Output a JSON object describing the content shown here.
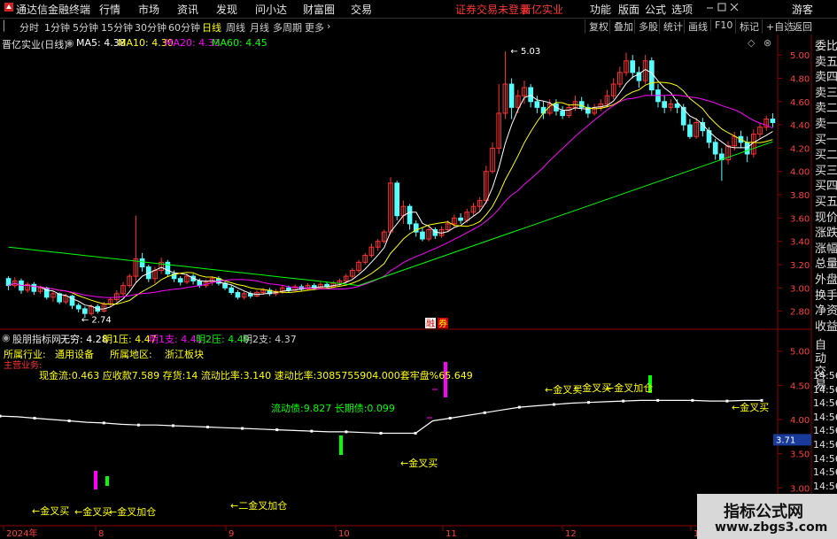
{
  "topbar": {
    "app_title": "通达信金融终端",
    "menu": [
      "行情",
      "市场",
      "资讯",
      "发现",
      "问小达",
      "财富圈",
      "交易"
    ],
    "notice": "证券交易未登录",
    "stock_name": "晋亿实业",
    "right": [
      "功能",
      "版面",
      "公式",
      "选项"
    ],
    "user": "游客"
  },
  "periods": [
    "分时",
    "1分钟",
    "5分钟",
    "15分钟",
    "30分钟",
    "60分钟",
    "日线",
    "周线",
    "月线",
    "多周期",
    "更多"
  ],
  "active_period": "日线",
  "toolbar": [
    "复权",
    "叠加",
    "多股",
    "统计",
    "画线",
    "F10",
    "标记",
    "+自选",
    "返回"
  ],
  "main_chart": {
    "title": "晋亿实业(日线)",
    "ma_legend": [
      {
        "label": "MA5: 4.38",
        "color": "#ffffff"
      },
      {
        "label": "MA10: 4.30",
        "color": "#ffff00"
      },
      {
        "label": "MA20: 4.33",
        "color": "#ff00ff"
      },
      {
        "label": "MA60: 4.45",
        "color": "#00ff00"
      }
    ],
    "y_ticks": [
      "5.00",
      "4.80",
      "4.60",
      "4.40",
      "4.20",
      "4.00",
      "3.80",
      "3.60",
      "3.40",
      "3.20",
      "3.00",
      "2.80"
    ],
    "high_label": "5.03",
    "low_label": "2.74",
    "marker_texts": [
      "融",
      "券"
    ]
  },
  "indicator": {
    "title": "股朋指标网",
    "values": [
      {
        "label": "无穷: 4.28",
        "color": "#ffffff"
      },
      {
        "label": "明1压: 4.47",
        "color": "#ffff00"
      },
      {
        "label": "明1支: 4.41",
        "color": "#ff00ff"
      },
      {
        "label": "明2压: 4.49",
        "color": "#00ff00"
      },
      {
        "label": "明2支: 4.37",
        "color": "#cccccc"
      }
    ],
    "industry_label": "所属行业:",
    "industry": "通用设备",
    "region_label": "所属地区:",
    "region": "浙江板块",
    "business_label": "主营业务:",
    "finance_line": "现金流:0.463    应收款7.589   存货:14      流动比率:3.140  速动比率:3085755904.000套牢盘%65.649",
    "debt_line": "流动债:9.827    长期债:0.099",
    "y_ticks": [
      "5.00",
      "4.50",
      "4.00",
      "3.50",
      "3.00"
    ],
    "current_value": "3.71",
    "annotations": [
      "←金叉买",
      "←金叉买",
      "←二金叉加仓",
      "←金叉买",
      "←金叉买",
      "←金叉买",
      "←金叉买",
      "←金叉加仓",
      "←金叉加仓"
    ]
  },
  "right_panel": {
    "items": [
      "委比",
      "卖五",
      "卖四",
      "卖三",
      "卖二",
      "卖一",
      "买一",
      "买二",
      "买三",
      "买四",
      "买五",
      "现价",
      "涨跌",
      "涨幅",
      "总量",
      "外盘",
      "换手",
      "净资",
      "收益"
    ],
    "lower_items": [
      "自动",
      "交易"
    ],
    "times": [
      "14:56",
      "14:56",
      "14:56",
      "14:56",
      "14:56",
      "14:56",
      "14:56",
      "14:56",
      "14:56"
    ]
  },
  "x_axis": [
    "2024年",
    "8",
    "9",
    "10",
    "11",
    "12",
    "1"
  ],
  "watermark": {
    "title": "指标公式网",
    "url": "www.zbgs3.com"
  },
  "colors": {
    "up": "#ff3232",
    "down": "#54ffff",
    "ma5": "#ffffff",
    "ma10": "#ffff00",
    "ma20": "#ff00ff",
    "ma60": "#00ff00"
  },
  "chart_data": {
    "type": "candlestick",
    "title": "晋亿实业(日线)",
    "ylim": [
      2.7,
      5.1
    ],
    "candles": [
      [
        3.08,
        3.02,
        3.1,
        2.98
      ],
      [
        3.02,
        3.06,
        3.09,
        3.0
      ],
      [
        3.06,
        2.98,
        3.08,
        2.95
      ],
      [
        2.98,
        3.03,
        3.05,
        2.96
      ],
      [
        3.03,
        2.97,
        3.05,
        2.94
      ],
      [
        2.97,
        3.0,
        3.02,
        2.95
      ],
      [
        3.0,
        2.92,
        3.01,
        2.9
      ],
      [
        2.92,
        2.95,
        2.97,
        2.88
      ],
      [
        2.95,
        2.88,
        2.96,
        2.86
      ],
      [
        2.88,
        2.93,
        2.95,
        2.86
      ],
      [
        2.93,
        2.85,
        2.94,
        2.82
      ],
      [
        2.85,
        2.82,
        2.87,
        2.79
      ],
      [
        2.82,
        2.78,
        2.84,
        2.74
      ],
      [
        2.78,
        2.84,
        2.86,
        2.76
      ],
      [
        2.84,
        2.8,
        2.86,
        2.78
      ],
      [
        2.8,
        2.86,
        2.88,
        2.79
      ],
      [
        2.86,
        2.9,
        2.92,
        2.84
      ],
      [
        2.9,
        2.95,
        2.98,
        2.88
      ],
      [
        2.95,
        3.02,
        3.05,
        2.93
      ],
      [
        3.02,
        3.1,
        3.12,
        3.0
      ],
      [
        3.1,
        3.25,
        3.62,
        3.05
      ],
      [
        3.25,
        3.18,
        3.3,
        3.14
      ],
      [
        3.18,
        3.08,
        3.2,
        3.05
      ],
      [
        3.08,
        3.15,
        3.18,
        3.04
      ],
      [
        3.15,
        3.22,
        3.26,
        3.12
      ],
      [
        3.22,
        3.12,
        3.24,
        3.1
      ],
      [
        3.12,
        3.08,
        3.15,
        3.05
      ],
      [
        3.08,
        3.05,
        3.1,
        3.02
      ],
      [
        3.05,
        3.1,
        3.12,
        3.03
      ],
      [
        3.1,
        3.06,
        3.12,
        3.03
      ],
      [
        3.06,
        3.02,
        3.08,
        3.0
      ],
      [
        3.02,
        3.05,
        3.07,
        3.0
      ],
      [
        3.05,
        3.08,
        3.1,
        3.02
      ],
      [
        3.08,
        3.04,
        3.1,
        3.02
      ],
      [
        3.04,
        3.0,
        3.06,
        2.98
      ],
      [
        3.0,
        2.96,
        3.02,
        2.94
      ],
      [
        2.96,
        2.92,
        2.98,
        2.9
      ],
      [
        2.92,
        2.95,
        2.97,
        2.9
      ],
      [
        2.95,
        2.93,
        2.97,
        2.91
      ],
      [
        2.93,
        2.96,
        2.98,
        2.92
      ],
      [
        2.96,
        2.98,
        3.0,
        2.94
      ],
      [
        2.98,
        2.95,
        3.0,
        2.93
      ],
      [
        2.95,
        2.97,
        2.99,
        2.93
      ],
      [
        2.97,
        3.0,
        3.02,
        2.95
      ],
      [
        3.0,
        2.98,
        3.02,
        2.96
      ],
      [
        2.98,
        3.01,
        3.03,
        2.97
      ],
      [
        3.01,
        2.99,
        3.03,
        2.97
      ],
      [
        2.99,
        3.02,
        3.04,
        2.98
      ],
      [
        3.02,
        3.0,
        3.04,
        2.98
      ],
      [
        3.0,
        3.03,
        3.05,
        2.99
      ],
      [
        3.03,
        3.01,
        3.05,
        2.99
      ],
      [
        3.01,
        3.04,
        3.06,
        3.0
      ],
      [
        3.04,
        3.06,
        3.08,
        3.02
      ],
      [
        3.06,
        3.1,
        3.12,
        3.04
      ],
      [
        3.1,
        3.15,
        3.17,
        3.08
      ],
      [
        3.15,
        3.22,
        3.24,
        3.13
      ],
      [
        3.22,
        3.28,
        3.3,
        3.2
      ],
      [
        3.28,
        3.35,
        3.38,
        3.26
      ],
      [
        3.35,
        3.4,
        3.42,
        3.32
      ],
      [
        3.4,
        3.48,
        3.5,
        3.38
      ],
      [
        3.48,
        3.9,
        3.95,
        3.46
      ],
      [
        3.9,
        3.62,
        3.92,
        3.58
      ],
      [
        3.62,
        3.7,
        3.75,
        3.55
      ],
      [
        3.7,
        3.55,
        3.72,
        3.5
      ],
      [
        3.55,
        3.48,
        3.58,
        3.44
      ],
      [
        3.48,
        3.42,
        3.52,
        3.4
      ],
      [
        3.42,
        3.5,
        3.53,
        3.4
      ],
      [
        3.5,
        3.45,
        3.52,
        3.42
      ],
      [
        3.45,
        3.5,
        3.53,
        3.43
      ],
      [
        3.5,
        3.55,
        3.58,
        3.48
      ],
      [
        3.55,
        3.6,
        3.63,
        3.52
      ],
      [
        3.6,
        3.58,
        3.64,
        3.55
      ],
      [
        3.58,
        3.65,
        3.68,
        3.56
      ],
      [
        3.65,
        3.7,
        3.73,
        3.62
      ],
      [
        3.7,
        3.75,
        3.78,
        3.66
      ],
      [
        3.75,
        4.0,
        4.05,
        3.72
      ],
      [
        4.0,
        4.2,
        4.25,
        3.98
      ],
      [
        4.2,
        4.5,
        4.75,
        4.15
      ],
      [
        4.5,
        4.75,
        5.03,
        4.45
      ],
      [
        4.75,
        4.55,
        4.8,
        4.45
      ],
      [
        4.55,
        4.65,
        4.7,
        4.5
      ],
      [
        4.65,
        4.72,
        4.78,
        4.58
      ],
      [
        4.72,
        4.6,
        4.75,
        4.55
      ],
      [
        4.6,
        4.55,
        4.65,
        4.5
      ],
      [
        4.55,
        4.5,
        4.6,
        4.45
      ],
      [
        4.5,
        4.58,
        4.62,
        4.48
      ],
      [
        4.58,
        4.52,
        4.62,
        4.48
      ],
      [
        4.52,
        4.48,
        4.56,
        4.45
      ],
      [
        4.48,
        4.55,
        4.58,
        4.46
      ],
      [
        4.55,
        4.6,
        4.65,
        4.52
      ],
      [
        4.6,
        4.55,
        4.64,
        4.52
      ],
      [
        4.55,
        4.5,
        4.58,
        4.46
      ],
      [
        4.5,
        4.55,
        4.58,
        4.48
      ],
      [
        4.55,
        4.58,
        4.62,
        4.52
      ],
      [
        4.58,
        4.65,
        4.7,
        4.55
      ],
      [
        4.65,
        4.75,
        4.8,
        4.62
      ],
      [
        4.75,
        4.85,
        4.9,
        4.72
      ],
      [
        4.85,
        4.95,
        5.02,
        4.82
      ],
      [
        4.95,
        4.85,
        5.0,
        4.8
      ],
      [
        4.85,
        4.78,
        4.9,
        4.72
      ],
      [
        4.78,
        4.95,
        5.0,
        4.75
      ],
      [
        4.95,
        4.7,
        4.98,
        4.65
      ],
      [
        4.7,
        4.6,
        4.75,
        4.55
      ],
      [
        4.6,
        4.55,
        4.65,
        4.5
      ],
      [
        4.55,
        4.58,
        4.62,
        4.52
      ],
      [
        4.58,
        4.55,
        4.62,
        4.5
      ],
      [
        4.55,
        4.4,
        4.58,
        4.35
      ],
      [
        4.4,
        4.3,
        4.45,
        4.28
      ],
      [
        4.3,
        4.42,
        4.46,
        4.28
      ],
      [
        4.42,
        4.35,
        4.46,
        4.3
      ],
      [
        4.35,
        4.25,
        4.38,
        4.2
      ],
      [
        4.25,
        4.15,
        4.28,
        4.1
      ],
      [
        4.15,
        4.1,
        4.2,
        3.92
      ],
      [
        4.1,
        4.22,
        4.26,
        4.06
      ],
      [
        4.22,
        4.3,
        4.34,
        4.18
      ],
      [
        4.3,
        4.25,
        4.35,
        4.2
      ],
      [
        4.25,
        4.15,
        4.3,
        4.08
      ],
      [
        4.15,
        4.32,
        4.36,
        4.12
      ],
      [
        4.32,
        4.38,
        4.42,
        4.28
      ],
      [
        4.38,
        4.45,
        4.48,
        4.35
      ],
      [
        4.45,
        4.42,
        4.5,
        4.38
      ]
    ],
    "series": [
      {
        "name": "MA5"
      },
      {
        "name": "MA10"
      },
      {
        "name": "MA20"
      },
      {
        "name": "MA60"
      }
    ]
  }
}
